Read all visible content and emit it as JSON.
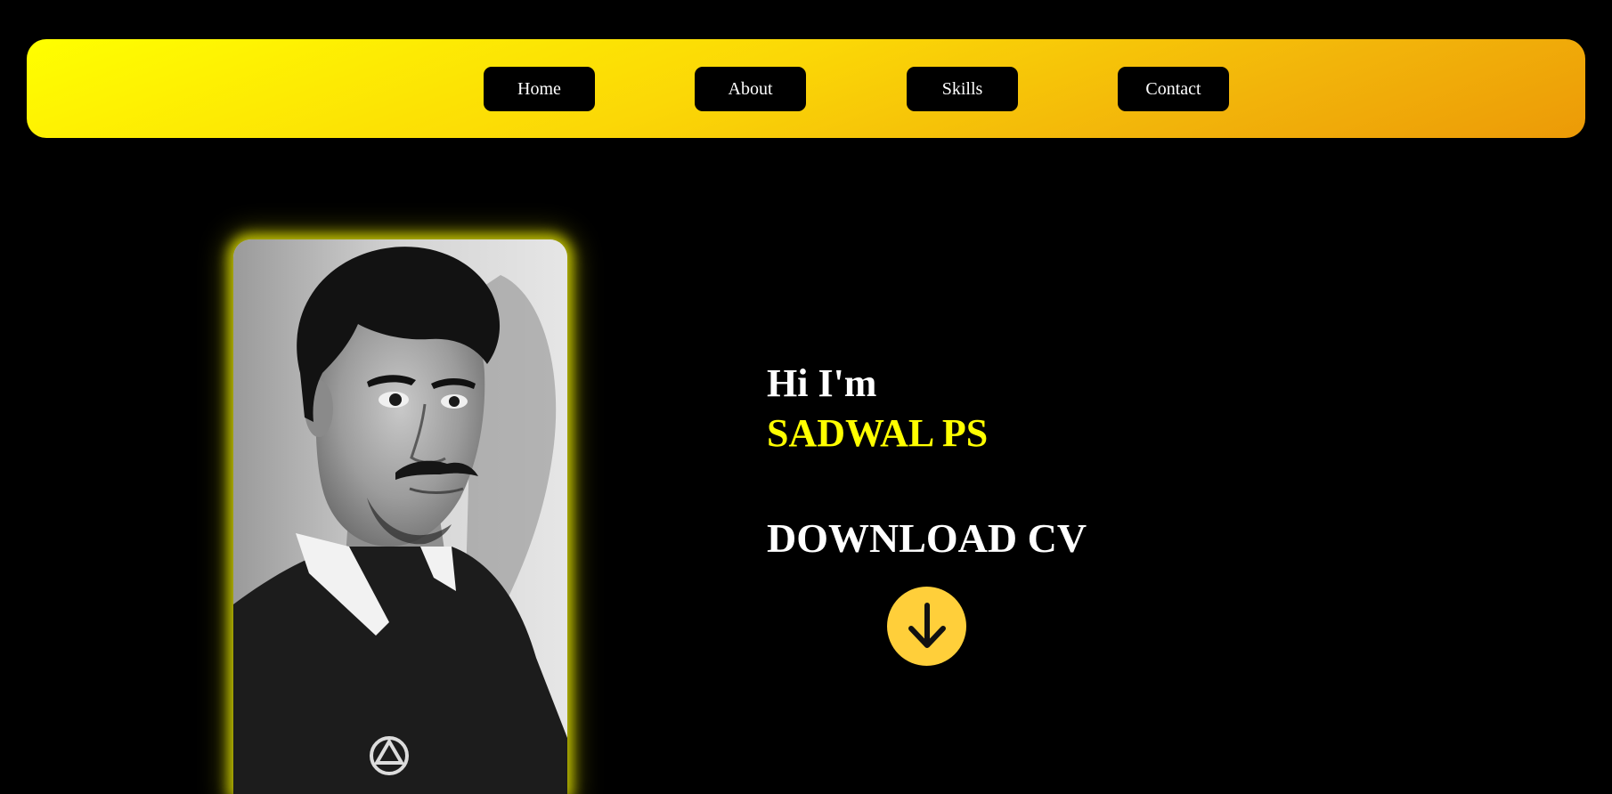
{
  "nav": {
    "items": [
      {
        "label": "Home"
      },
      {
        "label": "About"
      },
      {
        "label": "Skills"
      },
      {
        "label": "Contact"
      }
    ]
  },
  "hero": {
    "greeting": "Hi I'm",
    "name": "SADWAL PS",
    "download_label": "DOWNLOAD CV",
    "download_icon": "arrow-down-icon"
  },
  "colors": {
    "background": "#000000",
    "accent": "#ffff00",
    "navbar_gradient_start": "#ffff00",
    "navbar_gradient_end": "#ec9a07",
    "button": "#000000",
    "download_circle": "#ffcf3a"
  }
}
